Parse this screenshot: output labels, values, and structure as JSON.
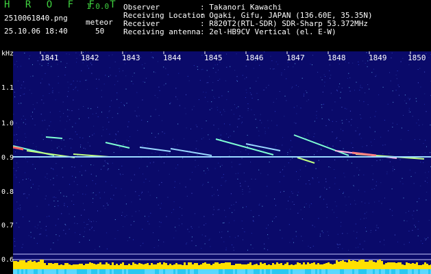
{
  "app": {
    "name": "H R O F F T",
    "version": "1.0.0"
  },
  "file": {
    "name": "2510061840.png",
    "datetime": "25.10.06 18:40"
  },
  "meteor": {
    "label": "meteor",
    "count": "50"
  },
  "info": [
    {
      "key": "Observer",
      "value": ": Takanori Kawachi"
    },
    {
      "key": "Receiving Location",
      "value": ": Ogaki, Gifu, JAPAN (136.60E, 35.35N)"
    },
    {
      "key": "Receiver",
      "value": ": R820T2(RTL-SDR) SDR-Sharp 53.372MHz"
    },
    {
      "key": "Receiving antenna",
      "value": ": 2el-HB9CV Vertical (el. E-W)"
    }
  ],
  "y_axis": {
    "unit": "kHz",
    "ticks": [
      "1.1",
      "1.0",
      "0.9",
      "0.8",
      "0.7",
      "0.6"
    ]
  },
  "x_axis": {
    "ticks": [
      "1841",
      "1842",
      "1843",
      "1844",
      "1845",
      "1846",
      "1847",
      "1848",
      "1849",
      "1850"
    ]
  },
  "colors": {
    "background": "#0a0a6a",
    "header_green": "#3fd23f",
    "carrier": "#9ad8ff",
    "baseline": "#ffe000"
  }
}
